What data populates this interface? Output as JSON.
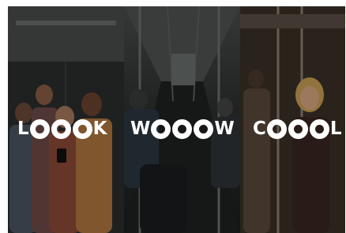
{
  "words": [
    {
      "start": "L",
      "end": "K"
    },
    {
      "start": "W",
      "end": "W"
    },
    {
      "start": "C",
      "end": "L"
    }
  ],
  "colors": {
    "text": "#ffffff",
    "panel_left": "#2a2c2c",
    "panel_middle": "#2d3130",
    "panel_right": "#3a3129"
  }
}
